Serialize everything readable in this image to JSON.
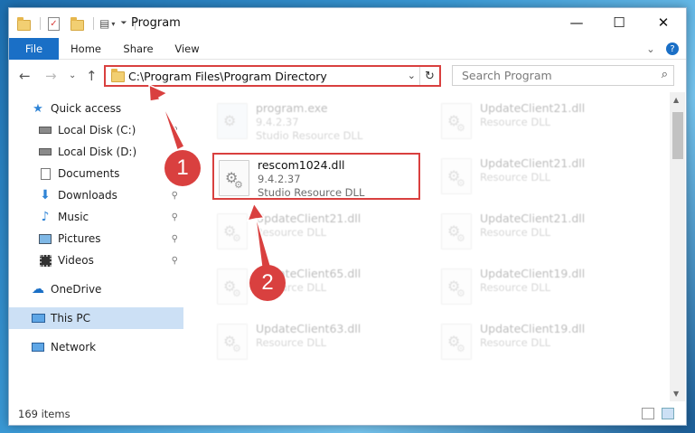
{
  "window": {
    "title": "Program",
    "minimize_glyph": "—",
    "maximize_glyph": "☐",
    "close_glyph": "✕"
  },
  "ribbon": {
    "tabs": [
      "File",
      "Home",
      "Share",
      "View"
    ],
    "expand_glyph": "⌄",
    "help_glyph": "?"
  },
  "nav": {
    "back_glyph": "←",
    "forward_glyph": "→",
    "recent_glyph": "⌄",
    "up_glyph": "↑"
  },
  "address": {
    "path": "C:\\Program Files\\Program Directory",
    "dropdown_glyph": "⌄",
    "refresh_glyph": "↻"
  },
  "search": {
    "placeholder": "Search Program",
    "icon_glyph": "⌕"
  },
  "sidebar": {
    "items": [
      {
        "label": "Quick access",
        "icon": "star-icon",
        "pinned": false
      },
      {
        "label": "Local Disk (C:)",
        "icon": "drive-icon",
        "pinned": true
      },
      {
        "label": "Local Disk (D:)",
        "icon": "drive-icon",
        "pinned": false
      },
      {
        "label": "Documents",
        "icon": "documents-icon",
        "pinned": true
      },
      {
        "label": "Downloads",
        "icon": "download-icon",
        "pinned": true
      },
      {
        "label": "Music",
        "icon": "music-icon",
        "pinned": true
      },
      {
        "label": "Pictures",
        "icon": "pictures-icon",
        "pinned": true
      },
      {
        "label": "Videos",
        "icon": "videos-icon",
        "pinned": true
      },
      {
        "label": "OneDrive",
        "icon": "cloud-icon",
        "pinned": false
      },
      {
        "label": "This PC",
        "icon": "computer-icon",
        "pinned": false,
        "selected": true
      },
      {
        "label": "Network",
        "icon": "network-icon",
        "pinned": false
      }
    ],
    "pin_glyph": "📌"
  },
  "files": [
    {
      "name": "program.exe",
      "version": "9.4.2.37",
      "desc": "Studio Resource DLL",
      "highlighted": false
    },
    {
      "name": "UpdateClient21.dll",
      "version": "",
      "desc": "Resource DLL",
      "highlighted": false
    },
    {
      "name": "rescom1024.dll",
      "version": "9.4.2.37",
      "desc": "Studio Resource DLL",
      "highlighted": true
    },
    {
      "name": "UpdateClient21.dll",
      "version": "",
      "desc": "Resource DLL",
      "highlighted": false
    },
    {
      "name": "UpdateClient21.dll",
      "version": "",
      "desc": "Resource DLL",
      "highlighted": false
    },
    {
      "name": "UpdateClient21.dll",
      "version": "",
      "desc": "Resource DLL",
      "highlighted": false
    },
    {
      "name": "UpdateClient65.dll",
      "version": "",
      "desc": "Resource DLL",
      "highlighted": false
    },
    {
      "name": "UpdateClient19.dll",
      "version": "",
      "desc": "Resource DLL",
      "highlighted": false
    },
    {
      "name": "UpdateClient63.dll",
      "version": "",
      "desc": "Resource DLL",
      "highlighted": false
    },
    {
      "name": "UpdateClient19.dll",
      "version": "",
      "desc": "Resource DLL",
      "highlighted": false
    }
  ],
  "status": {
    "count": "169 items"
  },
  "annotations": {
    "step1": "1",
    "step2": "2",
    "accent": "#d9403f"
  }
}
